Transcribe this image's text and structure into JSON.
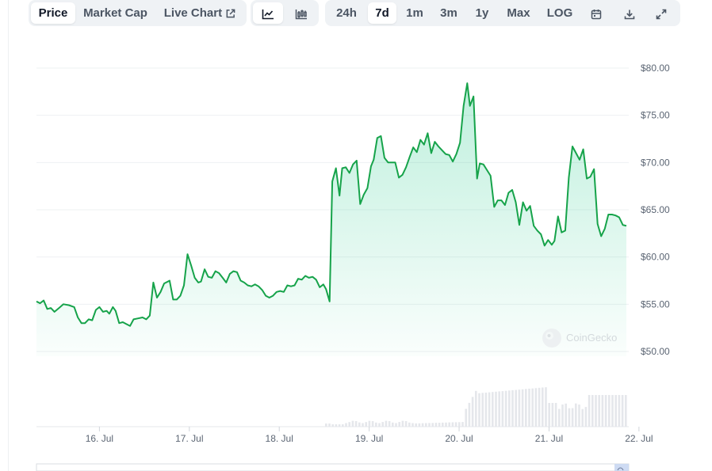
{
  "tabs": {
    "price": "Price",
    "market_cap": "Market Cap",
    "live_chart": "Live Chart"
  },
  "ranges": [
    "24h",
    "7d",
    "1m",
    "3m",
    "1y",
    "Max",
    "LOG"
  ],
  "active_range": "7d",
  "icons": {
    "external": "external-link-icon",
    "line": "line-chart-icon",
    "candle": "candlestick-icon",
    "calendar": "calendar-icon",
    "download": "download-icon",
    "expand": "expand-icon"
  },
  "watermark": "CoinGecko",
  "colors": {
    "line": "#16a34a",
    "fill": "#16c784",
    "volume": "#e5e7eb",
    "grid": "#eef0f2"
  },
  "chart_data": {
    "type": "area",
    "y_ticks": [
      "$80.00",
      "$75.00",
      "$70.00",
      "$65.00",
      "$60.00",
      "$55.00",
      "$50.00"
    ],
    "y_tick_values": [
      80,
      75,
      70,
      65,
      60,
      55,
      50
    ],
    "x_ticks": [
      "16. Jul",
      "17. Jul",
      "18. Jul",
      "19. Jul",
      "20. Jul",
      "21. Jul",
      "22. Jul"
    ],
    "x_tick_values": [
      1,
      2,
      3,
      4,
      5,
      6,
      7
    ],
    "xlim": [
      0.3,
      7.4
    ],
    "ylim": [
      48,
      82
    ],
    "price": [
      [
        0.3,
        55.3
      ],
      [
        0.34,
        55.1
      ],
      [
        0.38,
        55.4
      ],
      [
        0.42,
        54.5
      ],
      [
        0.46,
        54.6
      ],
      [
        0.5,
        54.2
      ],
      [
        0.55,
        54.6
      ],
      [
        0.6,
        55.0
      ],
      [
        0.66,
        54.9
      ],
      [
        0.72,
        54.7
      ],
      [
        0.76,
        53.6
      ],
      [
        0.8,
        53.0
      ],
      [
        0.84,
        53.0
      ],
      [
        0.88,
        53.4
      ],
      [
        0.92,
        53.3
      ],
      [
        0.96,
        54.4
      ],
      [
        1.0,
        54.7
      ],
      [
        1.04,
        54.2
      ],
      [
        1.08,
        54.3
      ],
      [
        1.11,
        54.0
      ],
      [
        1.15,
        54.7
      ],
      [
        1.18,
        54.3
      ],
      [
        1.22,
        53.0
      ],
      [
        1.26,
        53.1
      ],
      [
        1.3,
        52.9
      ],
      [
        1.34,
        52.7
      ],
      [
        1.38,
        53.4
      ],
      [
        1.43,
        53.5
      ],
      [
        1.48,
        53.6
      ],
      [
        1.52,
        53.4
      ],
      [
        1.56,
        53.8
      ],
      [
        1.6,
        57.3
      ],
      [
        1.64,
        55.7
      ],
      [
        1.68,
        56.3
      ],
      [
        1.72,
        57.2
      ],
      [
        1.76,
        57.4
      ],
      [
        1.78,
        57.5
      ],
      [
        1.82,
        55.5
      ],
      [
        1.86,
        55.5
      ],
      [
        1.9,
        55.9
      ],
      [
        1.94,
        57.0
      ],
      [
        1.98,
        60.3
      ],
      [
        2.02,
        59.1
      ],
      [
        2.06,
        57.8
      ],
      [
        2.1,
        57.3
      ],
      [
        2.13,
        57.4
      ],
      [
        2.17,
        58.7
      ],
      [
        2.21,
        57.9
      ],
      [
        2.25,
        57.8
      ],
      [
        2.29,
        58.5
      ],
      [
        2.33,
        58.3
      ],
      [
        2.37,
        57.8
      ],
      [
        2.41,
        57.3
      ],
      [
        2.45,
        58.2
      ],
      [
        2.49,
        58.5
      ],
      [
        2.53,
        58.4
      ],
      [
        2.57,
        57.5
      ],
      [
        2.61,
        57.3
      ],
      [
        2.65,
        57.0
      ],
      [
        2.69,
        56.9
      ],
      [
        2.73,
        57.1
      ],
      [
        2.77,
        56.9
      ],
      [
        2.81,
        56.5
      ],
      [
        2.85,
        55.9
      ],
      [
        2.89,
        55.7
      ],
      [
        2.93,
        55.9
      ],
      [
        2.97,
        56.3
      ],
      [
        3.01,
        56.4
      ],
      [
        3.05,
        56.3
      ],
      [
        3.09,
        57.0
      ],
      [
        3.13,
        56.9
      ],
      [
        3.17,
        57.0
      ],
      [
        3.21,
        57.7
      ],
      [
        3.25,
        57.6
      ],
      [
        3.29,
        58.0
      ],
      [
        3.33,
        57.8
      ],
      [
        3.37,
        57.9
      ],
      [
        3.41,
        57.6
      ],
      [
        3.45,
        56.8
      ],
      [
        3.49,
        57.1
      ],
      [
        3.52,
        56.6
      ],
      [
        3.56,
        55.3
      ],
      [
        3.59,
        68.0
      ],
      [
        3.63,
        69.4
      ],
      [
        3.67,
        66.5
      ],
      [
        3.7,
        69.4
      ],
      [
        3.74,
        69.5
      ],
      [
        3.78,
        68.9
      ],
      [
        3.82,
        69.8
      ],
      [
        3.86,
        70.2
      ],
      [
        3.9,
        65.6
      ],
      [
        3.94,
        66.6
      ],
      [
        3.98,
        67.3
      ],
      [
        4.02,
        69.6
      ],
      [
        4.05,
        70.3
      ],
      [
        4.09,
        72.6
      ],
      [
        4.13,
        72.8
      ],
      [
        4.17,
        70.5
      ],
      [
        4.21,
        70.0
      ],
      [
        4.25,
        70.0
      ],
      [
        4.29,
        70.0
      ],
      [
        4.33,
        68.4
      ],
      [
        4.37,
        68.7
      ],
      [
        4.41,
        69.5
      ],
      [
        4.45,
        70.6
      ],
      [
        4.49,
        71.6
      ],
      [
        4.53,
        71.1
      ],
      [
        4.57,
        72.4
      ],
      [
        4.61,
        71.9
      ],
      [
        4.65,
        73.1
      ],
      [
        4.69,
        71.0
      ],
      [
        4.73,
        72.2
      ],
      [
        4.77,
        71.7
      ],
      [
        4.81,
        71.3
      ],
      [
        4.85,
        70.9
      ],
      [
        4.89,
        70.8
      ],
      [
        4.93,
        70.1
      ],
      [
        4.97,
        70.9
      ],
      [
        5.01,
        72.1
      ],
      [
        5.05,
        76.0
      ],
      [
        5.09,
        78.4
      ],
      [
        5.12,
        76.0
      ],
      [
        5.16,
        77.0
      ],
      [
        5.2,
        68.3
      ],
      [
        5.23,
        69.9
      ],
      [
        5.27,
        69.8
      ],
      [
        5.31,
        69.2
      ],
      [
        5.35,
        68.6
      ],
      [
        5.39,
        65.3
      ],
      [
        5.43,
        66.0
      ],
      [
        5.47,
        66.0
      ],
      [
        5.51,
        65.5
      ],
      [
        5.55,
        66.8
      ],
      [
        5.59,
        67.1
      ],
      [
        5.63,
        65.8
      ],
      [
        5.67,
        63.4
      ],
      [
        5.71,
        65.8
      ],
      [
        5.75,
        64.9
      ],
      [
        5.79,
        65.4
      ],
      [
        5.83,
        63.3
      ],
      [
        5.87,
        62.8
      ],
      [
        5.91,
        62.4
      ],
      [
        5.95,
        61.2
      ],
      [
        5.99,
        61.8
      ],
      [
        6.03,
        61.3
      ],
      [
        6.06,
        61.7
      ],
      [
        6.1,
        64.3
      ],
      [
        6.14,
        62.6
      ],
      [
        6.18,
        62.8
      ],
      [
        6.22,
        68.4
      ],
      [
        6.26,
        71.7
      ],
      [
        6.3,
        71.0
      ],
      [
        6.34,
        70.3
      ],
      [
        6.38,
        71.4
      ],
      [
        6.42,
        68.3
      ],
      [
        6.46,
        68.5
      ],
      [
        6.5,
        69.3
      ],
      [
        6.54,
        63.5
      ],
      [
        6.58,
        62.2
      ],
      [
        6.62,
        63.0
      ],
      [
        6.66,
        64.5
      ],
      [
        6.7,
        64.5
      ],
      [
        6.74,
        64.4
      ],
      [
        6.78,
        64.2
      ],
      [
        6.82,
        63.4
      ],
      [
        6.86,
        63.3
      ]
    ]
  }
}
